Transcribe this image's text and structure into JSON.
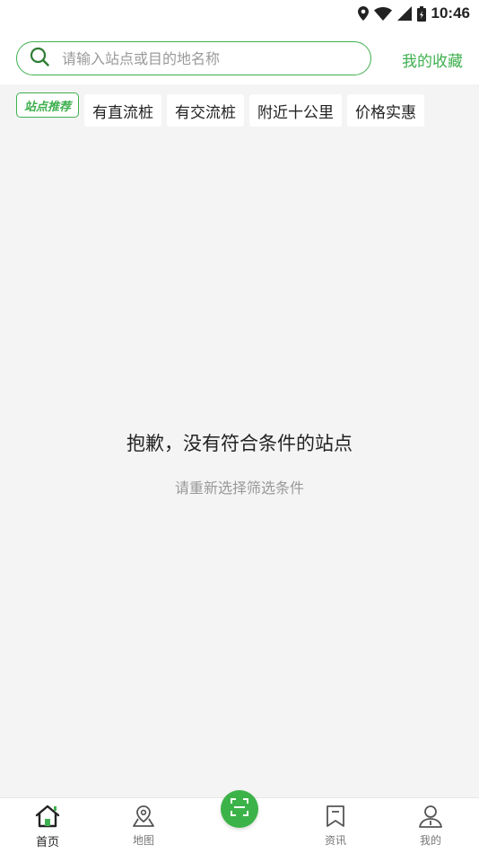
{
  "status_bar": {
    "time": "10:46"
  },
  "search": {
    "placeholder": "请输入站点或目的地名称"
  },
  "header": {
    "favorites_label": "我的收藏"
  },
  "filters": {
    "badge_label": "站点推荐",
    "chips": [
      "有直流桩",
      "有交流桩",
      "附近十公里",
      "价格实惠"
    ]
  },
  "empty_state": {
    "title": "抱歉，没有符合条件的站点",
    "subtitle": "请重新选择筛选条件"
  },
  "tab_bar": {
    "tabs": [
      {
        "label": "首页",
        "icon": "home-icon"
      },
      {
        "label": "地图",
        "icon": "map-pin-icon"
      },
      {
        "label": "资讯",
        "icon": "news-bookmark-icon"
      },
      {
        "label": "我的",
        "icon": "user-icon"
      }
    ],
    "center_icon": "scan-icon"
  },
  "colors": {
    "accent": "#3fb04f",
    "background": "#f4f4f4"
  }
}
